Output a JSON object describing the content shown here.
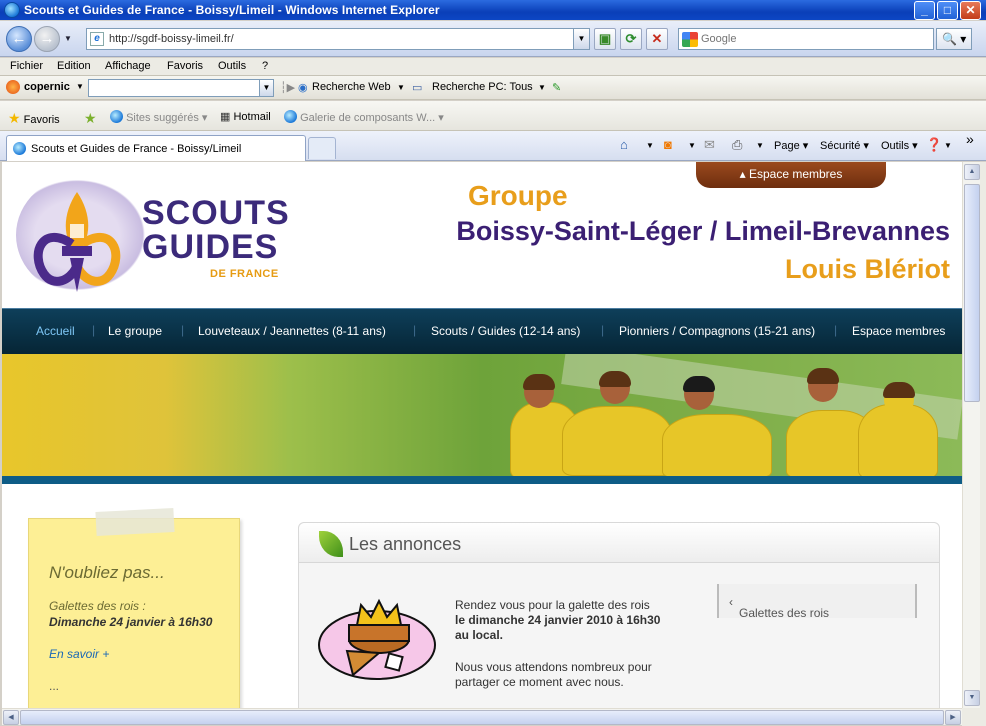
{
  "window": {
    "title": "Scouts et Guides de France - Boissy/Limeil - Windows Internet Explorer",
    "minimize": "_",
    "maximize": "□",
    "close": "✕"
  },
  "address": {
    "url": "http://sgdf-boissy-limeil.fr/",
    "search_placeholder": "Google"
  },
  "menu": [
    "Fichier",
    "Edition",
    "Affichage",
    "Favoris",
    "Outils",
    "?"
  ],
  "copernic": {
    "name": "copernic",
    "web": "Recherche Web",
    "pc": "Recherche PC: Tous"
  },
  "favorites": {
    "label": "Favoris",
    "suggested": "Sites suggérés",
    "hotmail": "Hotmail",
    "gallery": "Galerie de composants W..."
  },
  "tab": {
    "title": "Scouts et Guides de France - Boissy/Limeil"
  },
  "commands": {
    "page": "Page",
    "security": "Sécurité",
    "tools": "Outils",
    "more": "»"
  },
  "site": {
    "members_tab": "Espace membres",
    "logo": {
      "line1": "SCOUTS",
      "line2": "GUIDES",
      "line3": "DE FRANCE"
    },
    "groupe": "Groupe",
    "ville": "Boissy-Saint-Léger / Limeil-Brevannes",
    "louis": "Louis Blériot",
    "nav": [
      "Accueil",
      "Le groupe",
      "Louveteaux / Jeannettes (8-11 ans)",
      "Scouts / Guides (12-14 ans)",
      "Pionniers / Compagnons (15-21 ans)",
      "Espace membres"
    ],
    "note": {
      "heading": "N'oubliez pas...",
      "event": "Galettes des rois :",
      "date": "Dimanche 24 janvier à 16h30",
      "more": "En savoir +",
      "ellipsis": "..."
    },
    "annonces": {
      "title": "Les annonces",
      "p1_a": "Rendez vous pour la galette des rois",
      "p1_b": "le dimanche 24 janvier 2010 à 16h30 au local.",
      "p2": "Nous vous attendons nombreux pour partager ce moment avec nous.",
      "link": "Galettes des rois"
    }
  }
}
